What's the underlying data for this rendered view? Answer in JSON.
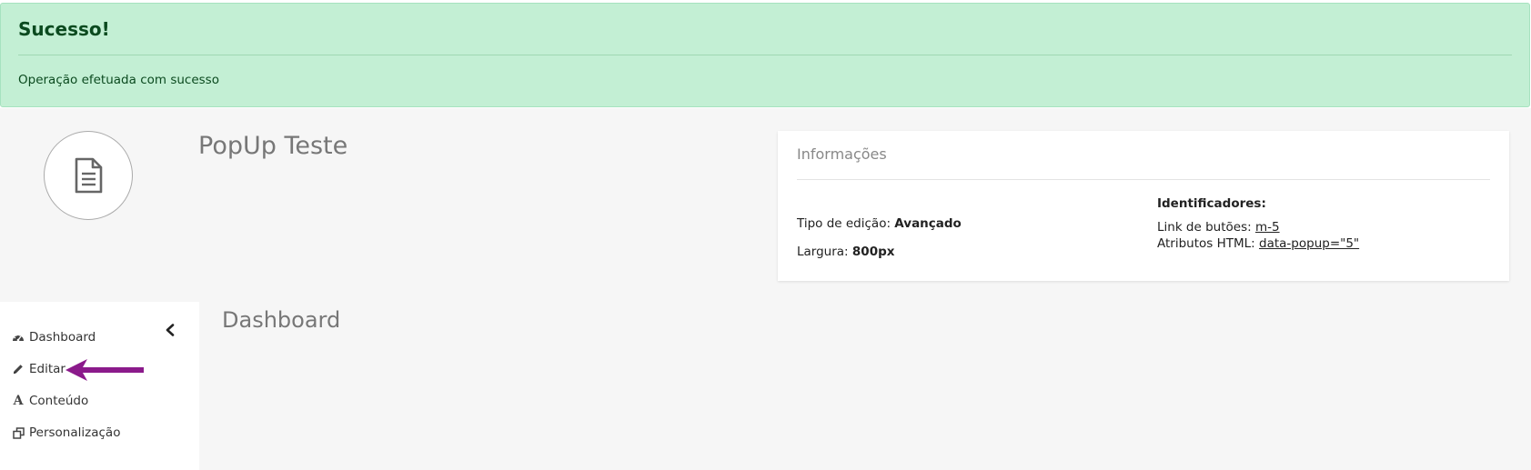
{
  "alert": {
    "title": "Sucesso!",
    "message": "Operação efetuada com sucesso",
    "color": "#c3efd4",
    "text_color": "#0b4a1f"
  },
  "header": {
    "popup_title": "PopUp Teste",
    "avatar_icon": "document-icon"
  },
  "info": {
    "title": "Informações",
    "edit_type_label": "Tipo de edição:",
    "edit_type_value": "Avançado",
    "width_label": "Largura:",
    "width_value": "800px",
    "identifiers_label": "Identificadores:",
    "button_link_label": "Link de butões:",
    "button_link_value": "m-5",
    "html_attrs_label": "Atributos HTML:",
    "html_attrs_value": "data-popup=\"5\""
  },
  "sidebar": {
    "collapse_icon": "chevron-left-icon",
    "items": [
      {
        "label": "Dashboard",
        "icon": "dashboard-icon"
      },
      {
        "label": "Editar",
        "icon": "pencil-icon"
      },
      {
        "label": "Conteúdo",
        "icon": "font-icon",
        "glyph": "A"
      },
      {
        "label": "Personalização",
        "icon": "clone-icon"
      }
    ]
  },
  "main": {
    "title": "Dashboard"
  },
  "annotation": {
    "color": "#8b1a8b",
    "icon": "arrow-left-icon"
  }
}
